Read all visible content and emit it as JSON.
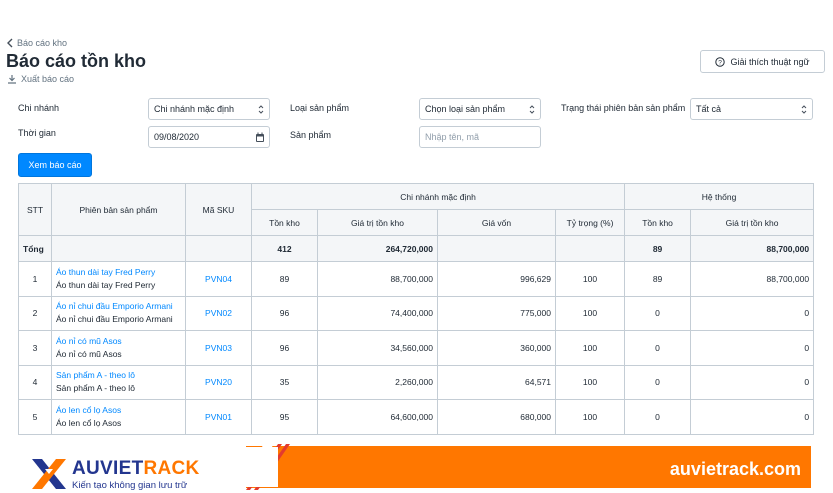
{
  "breadcrumb": "Báo cáo kho",
  "page_title": "Báo cáo tồn kho",
  "export_label": "Xuất báo cáo",
  "help_button": "Giải thích thuật ngữ",
  "filters": {
    "branch_label": "Chi nhánh",
    "branch_value": "Chi nhánh mặc định",
    "time_label": "Thời gian",
    "time_value": "09/08/2020",
    "product_type_label": "Loại sản phẩm",
    "product_type_value": "Chọn loại sản phẩm",
    "product_label": "Sản phẩm",
    "product_placeholder": "Nhập tên, mã",
    "status_label": "Trạng thái phiên bản sản phẩm",
    "status_value": "Tất cả"
  },
  "view_report_button": "Xem báo cáo",
  "table": {
    "headers": {
      "stt": "STT",
      "variant": "Phiên bản sản phẩm",
      "sku": "Mã SKU",
      "branch_group": "Chi nhánh mặc định",
      "system_group": "Hệ thống",
      "stock": "Tồn kho",
      "stock_value": "Giá trị tồn kho",
      "cost": "Giá vốn",
      "ratio": "Tỷ trọng (%)",
      "sys_stock": "Tồn kho",
      "sys_stock_value": "Giá trị tồn kho"
    },
    "total": {
      "label": "Tổng",
      "stock": "412",
      "stock_value": "264,720,000",
      "sys_stock": "89",
      "sys_stock_value": "88,700,000"
    },
    "rows": [
      {
        "stt": "1",
        "name": "Áo thun dài tay Fred Perry",
        "sub": "Áo thun dài tay Fred Perry",
        "sku": "PVN04",
        "stock": "89",
        "stock_value": "88,700,000",
        "cost": "996,629",
        "ratio": "100",
        "sys_stock": "89",
        "sys_stock_value": "88,700,000"
      },
      {
        "stt": "2",
        "name": "Áo nỉ chui đầu Emporio Armani",
        "sub": "Áo nỉ chui đầu Emporio Armani",
        "sku": "PVN02",
        "stock": "96",
        "stock_value": "74,400,000",
        "cost": "775,000",
        "ratio": "100",
        "sys_stock": "0",
        "sys_stock_value": "0"
      },
      {
        "stt": "3",
        "name": "Áo nỉ có mũ Asos",
        "sub": "Áo nỉ có mũ Asos",
        "sku": "PVN03",
        "stock": "96",
        "stock_value": "34,560,000",
        "cost": "360,000",
        "ratio": "100",
        "sys_stock": "0",
        "sys_stock_value": "0"
      },
      {
        "stt": "4",
        "name": "Sản phẩm A - theo lô",
        "sub": "Sản phẩm A - theo lô",
        "sku": "PVN20",
        "stock": "35",
        "stock_value": "2,260,000",
        "cost": "64,571",
        "ratio": "100",
        "sys_stock": "0",
        "sys_stock_value": "0"
      },
      {
        "stt": "5",
        "name": "Áo len cổ lọ Asos",
        "sub": "Áo len cổ lọ Asos",
        "sku": "PVN01",
        "stock": "95",
        "stock_value": "64,600,000",
        "cost": "680,000",
        "ratio": "100",
        "sys_stock": "0",
        "sys_stock_value": "0"
      }
    ]
  },
  "banner": {
    "brand_part1": "AUVIET",
    "brand_part2": "RACK",
    "tagline": "Kiến tạo không gian lưu trữ",
    "domain": "auvietrack.com",
    "colors": {
      "navy": "#23368f",
      "orange": "#ff7700"
    }
  }
}
